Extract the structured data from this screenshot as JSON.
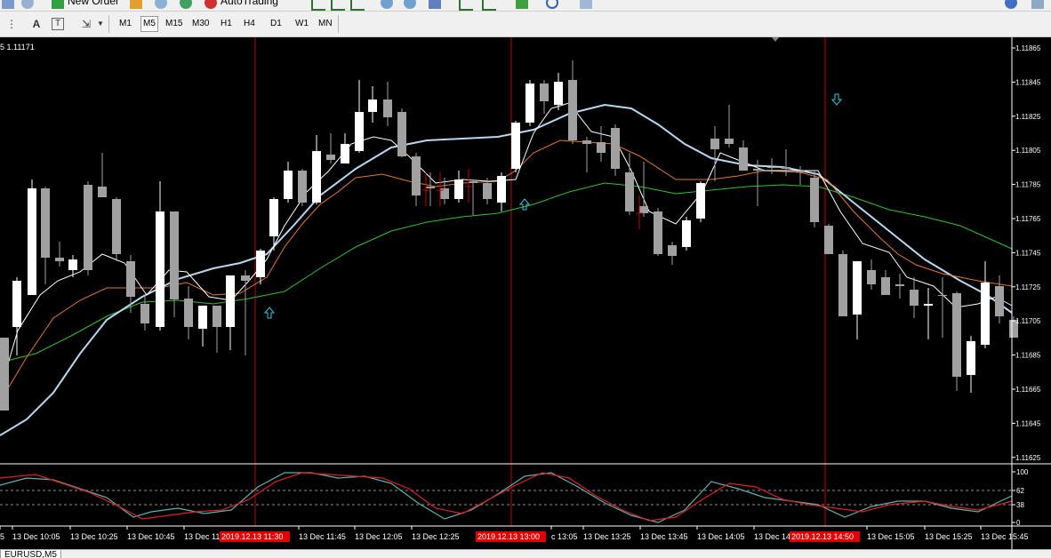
{
  "toolbar": {
    "new_order": "New Order",
    "auto_trading": "AutoTrading"
  },
  "timeframes": [
    "M1",
    "M5",
    "M15",
    "M30",
    "H1",
    "H4",
    "D1",
    "W1",
    "MN"
  ],
  "active_timeframe": "M5",
  "chart": {
    "info_label": "5 1.11171",
    "symbol_tab": "EURUSD,M5",
    "price_ticks": [
      "1.11865",
      "1.11845",
      "1.11825",
      "1.11805",
      "1.11785",
      "1.11765",
      "1.11745",
      "1.11725",
      "1.11705",
      "1.11685",
      "1.11665",
      "1.11645",
      "1.11625"
    ],
    "stoch_ticks": [
      "100",
      "62",
      "38",
      "0"
    ],
    "time_labels": [
      "5",
      "13 Dec 10:05",
      "13 Dec 10:25",
      "13 Dec 10:45",
      "13 Dec 11",
      "13 Dec 11:45",
      "13 Dec 12:05",
      "13 Dec 12:25",
      "c 13:05",
      "13 Dec 13:25",
      "13 Dec 13:45",
      "13 Dec 14:05",
      "13 Dec 14",
      "13 Dec 15:05",
      "13 Dec 15:25",
      "13 Dec 15:45"
    ],
    "highlighted_times": [
      "2019.12.13 11:30",
      "2019.12.13 13:00",
      "2019.12.13 14:50"
    ],
    "colors": {
      "background": "#000000",
      "bull_candle": "#ffffff",
      "bear_candle": "#a0a0a0",
      "ma_fast": "#ffffff",
      "ma_orange": "#e07830",
      "ma_lightblue": "#b8d8f0",
      "ma_green": "#30c030",
      "vline": "#c00000",
      "arrow": "#30c8d8",
      "stoch_main": "#5fb0b0",
      "stoch_signal": "#e02020",
      "time_highlight": "#e00000"
    }
  }
}
